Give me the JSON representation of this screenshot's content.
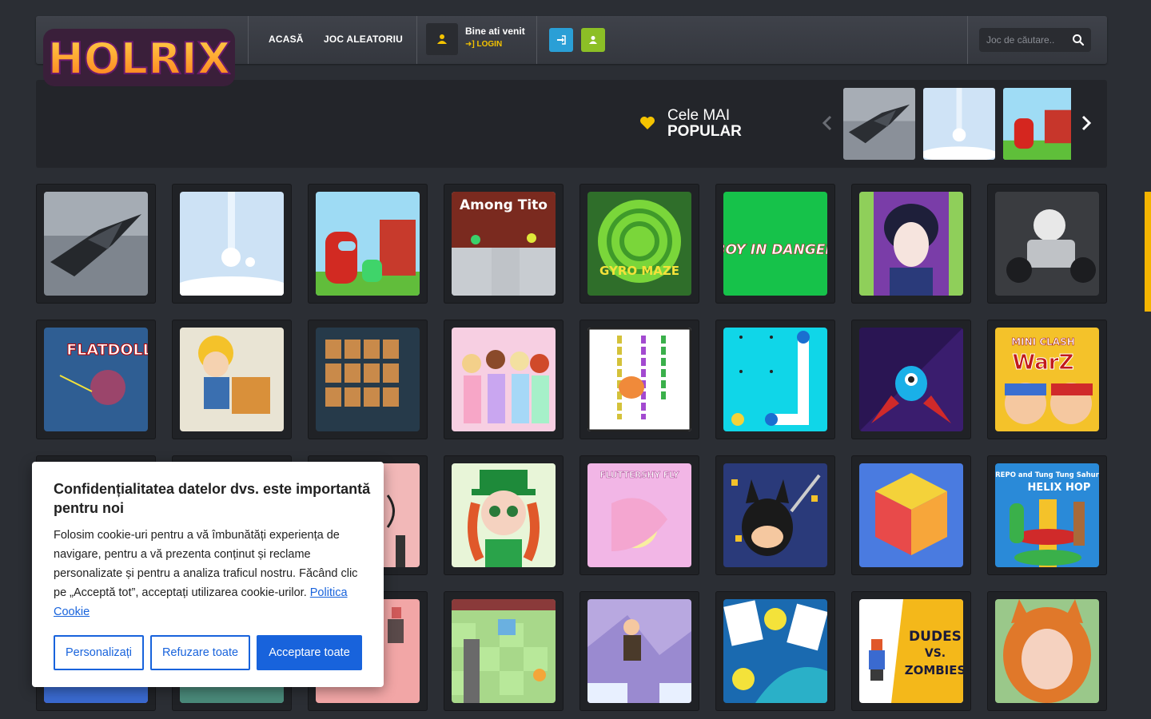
{
  "brand": {
    "logo_text": "HOLRIX"
  },
  "nav": {
    "home": "ACASĂ",
    "random": "JOC ALEATORIU"
  },
  "user": {
    "welcome": "Bine ati venit",
    "login": "LOGIN"
  },
  "search": {
    "placeholder": "Joc de căutare.."
  },
  "popular": {
    "title_line1": "Cele MAI",
    "title_line2": "POPULAR"
  },
  "carousel": [
    "spaceship",
    "snowball",
    "among-farm"
  ],
  "games": [
    {
      "id": "spaceship-flight"
    },
    {
      "id": "snowball-drop"
    },
    {
      "id": "among-us-farm"
    },
    {
      "id": "among-tito",
      "text": "Among Tito"
    },
    {
      "id": "gyro-maze",
      "text": "GYRO MAZE"
    },
    {
      "id": "boy-in-danger",
      "text": "BOY IN DANGER"
    },
    {
      "id": "geisha-dressup"
    },
    {
      "id": "kart-racer"
    },
    {
      "id": "flatdoll",
      "text": "FLATDOLL"
    },
    {
      "id": "warehouse-boxes"
    },
    {
      "id": "halloween-mahjong"
    },
    {
      "id": "princess-party"
    },
    {
      "id": "chain-puzzle"
    },
    {
      "id": "connect-dots"
    },
    {
      "id": "monster-rockets"
    },
    {
      "id": "mini-clash-warz",
      "text1": "MINI CLASH",
      "text2": "WarZ"
    },
    {
      "id": "tattoo-artist"
    },
    {
      "id": "lucky-doll"
    },
    {
      "id": "fluttershy-fly",
      "text": "FLUTTERSHY FLY"
    },
    {
      "id": "bat-hero-cut"
    },
    {
      "id": "rubik-cube"
    },
    {
      "id": "repo-helix",
      "text1": "REPO and Tung Tung Sahur",
      "text2": "HELIX HOP"
    },
    {
      "id": "hidden-girl"
    },
    {
      "id": "pixel-room"
    },
    {
      "id": "pink-escape"
    },
    {
      "id": "spike-jump"
    },
    {
      "id": "soldier-run"
    },
    {
      "id": "idea-cards"
    },
    {
      "id": "dudes-vs-zombies",
      "text1": "DUDES",
      "text2": "VS.",
      "text3": "ZOMBIES"
    },
    {
      "id": "fox-girl"
    }
  ],
  "cookie": {
    "title": "Confidențialitatea datelor dvs. este importantă pentru noi",
    "body": "Folosim cookie-uri pentru a vă îmbunătăți experiența de navigare, pentru a vă prezenta conținut și reclame personalizate și pentru a analiza traficul nostru. Făcând clic pe „Acceptă tot”, acceptați utilizarea cookie-urilor.",
    "policy_link": "Politica Cookie",
    "btn_customize": "Personalizați",
    "btn_reject": "Refuzare toate",
    "btn_accept": "Acceptare toate"
  },
  "colors": {
    "accent_yellow": "#f4c300",
    "blue": "#2a9fd6",
    "green": "#8cbf26",
    "cookie_blue": "#1863dc"
  }
}
